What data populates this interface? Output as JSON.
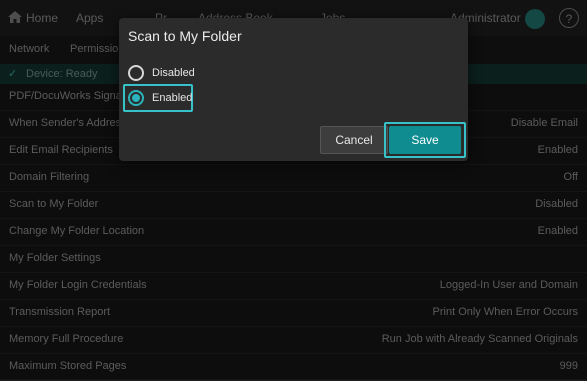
{
  "header": {
    "home": "Home",
    "apps": "Apps",
    "third": "Pr",
    "fourth": "Address Book",
    "fifth": "Jobs",
    "user": "Administrator",
    "help": "?"
  },
  "tabs": [
    "Network",
    "Permissions"
  ],
  "status": {
    "text": "Device: Ready"
  },
  "rows": [
    {
      "label": "PDF/DocuWorks Signature",
      "value": ""
    },
    {
      "label": "When Sender's Address Is Not Present",
      "value": "Disable Email"
    },
    {
      "label": "Edit Email Recipients",
      "value": "Enabled"
    },
    {
      "label": "Domain Filtering",
      "value": "Off"
    },
    {
      "label": "Scan to My Folder",
      "value": "Disabled"
    },
    {
      "label": "Change My Folder Location",
      "value": "Enabled"
    },
    {
      "label": "My Folder Settings",
      "value": ""
    },
    {
      "label": "My Folder Login Credentials",
      "value": "Logged-In User and Domain"
    },
    {
      "label": "Transmission Report",
      "value": "Print Only When Error Occurs"
    },
    {
      "label": "Memory Full Procedure",
      "value": "Run Job with Already Scanned Originals"
    },
    {
      "label": "Maximum Stored Pages",
      "value": "999"
    }
  ],
  "dialog": {
    "title": "Scan to My Folder",
    "options": [
      {
        "label": "Disabled",
        "selected": false
      },
      {
        "label": "Enabled",
        "selected": true
      }
    ],
    "cancel": "Cancel",
    "save": "Save"
  },
  "colors": {
    "accent": "#0e8c90",
    "focus": "#36c2c8"
  }
}
